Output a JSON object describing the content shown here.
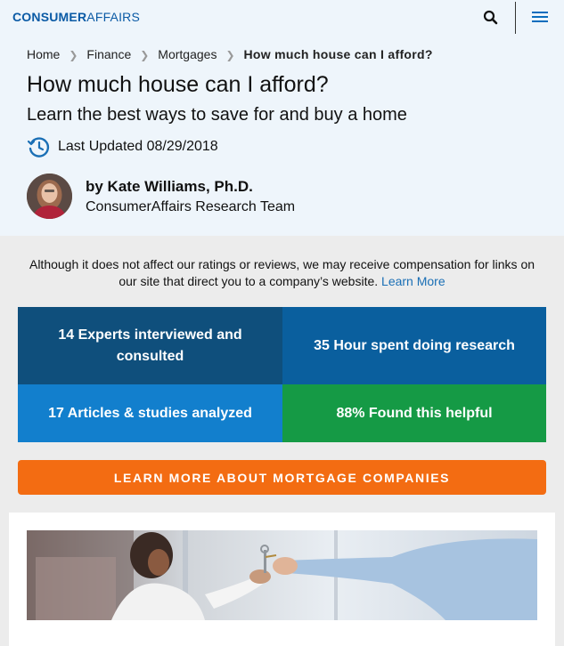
{
  "nav": {
    "logo_bold": "CONSUMER",
    "logo_light": "AFFAIRS",
    "search_icon": "search-icon",
    "menu_icon": "hamburger-menu-icon"
  },
  "breadcrumb": {
    "items": [
      "Home",
      "Finance",
      "Mortgages"
    ],
    "current": "How much house can I afford?"
  },
  "article": {
    "title": "How much house can I afford?",
    "subtitle": "Learn the best ways to save for and buy a home",
    "updated": "Last Updated 08/29/2018"
  },
  "author": {
    "name": "by Kate Williams, Ph.D.",
    "team": "ConsumerAffairs Research Team"
  },
  "disclaimer": {
    "text": "Although it does not affect our ratings or reviews, we may receive compensation for links on our site that direct you to a company’s website.",
    "link": "Learn More"
  },
  "stats": [
    "14 Experts interviewed and consulted",
    "35 Hour spent doing research",
    "17 Articles & studies analyzed",
    "88% Found this helpful"
  ],
  "cta": {
    "label": "LEARN MORE ABOUT MORTGAGE COMPANIES"
  },
  "colors": {
    "brand": "#0a5aa5",
    "header_bg": "#eef5fb",
    "stat_dark": "#0f4f7c",
    "stat_mid": "#0a5f9e",
    "stat_light": "#127fcd",
    "stat_green": "#159a45",
    "cta": "#f36c12"
  }
}
